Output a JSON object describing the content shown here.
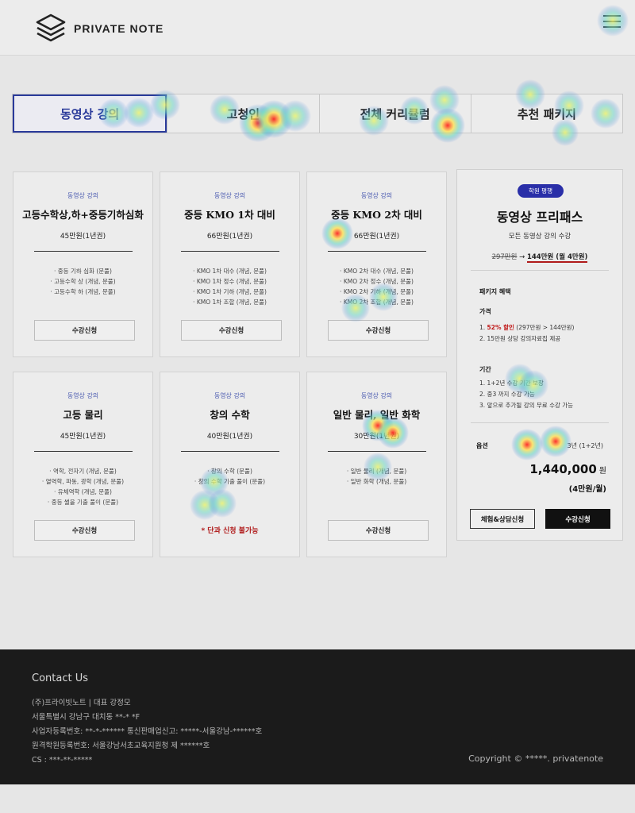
{
  "header": {
    "logo_text": "PRIVATE NOTE"
  },
  "tabs": [
    {
      "label": "동영상 강의"
    },
    {
      "label": "고청인"
    },
    {
      "label": "전체 커리큘럼"
    },
    {
      "label": "추천 패키지"
    }
  ],
  "courses": [
    {
      "category": "동영상 강의",
      "title": "고등수학상,하+중등기하심화",
      "price": "45만원(1년권)",
      "topics": [
        "· 중등 기하 심화 (문풀)",
        "· 고등수학 상 (개념, 문풀)",
        "· 고등수학 하 (개념, 문풀)"
      ],
      "button": "수강신청"
    },
    {
      "category": "동영상 강의",
      "title": "중등 KMO 1차 대비",
      "price": "66만원(1년권)",
      "topics": [
        "· KMO 1차 대수 (개념, 문풀)",
        "· KMO 1차 정수 (개념, 문풀)",
        "· KMO 1차 기하 (개념, 문풀)",
        "· KMO 1차 조합 (개념, 문풀)"
      ],
      "button": "수강신청"
    },
    {
      "category": "동영상 강의",
      "title": "중등 KMO 2차 대비",
      "price": "66만원(1년권)",
      "topics": [
        "· KMO 2차 대수 (개념, 문풀)",
        "· KMO 2차 정수 (개념, 문풀)",
        "· KMO 2차 기하 (개념, 문풀)",
        "· KMO 2차 조합 (개념, 문풀)"
      ],
      "button": "수강신청"
    },
    {
      "category": "동영상 강의",
      "title": "고등 물리",
      "price": "45만원(1년권)",
      "topics": [
        "· 역학, 전자기 (개념, 문풀)",
        "· 열역학, 파동, 광학 (개념, 문풀)",
        "· 유체역학 (개념, 문풀)",
        "· 중등 썰을 기출 풀이 (문풀)"
      ],
      "button": "수강신청"
    },
    {
      "category": "동영상 강의",
      "title": "창의 수학",
      "price": "40만원(1년권)",
      "topics": [
        "· 창의 수학 (문풀)",
        "· 창의 수학 기출 풀이 (문풀)"
      ],
      "notice": "* 단과 신청 불가능"
    },
    {
      "category": "동영상 강의",
      "title": "일반 물리, 일반 화학",
      "price": "30만원(1년권)",
      "topics": [
        "· 일반 물리 (개념, 문풀)",
        "· 일반 화학 (개념, 문풀)"
      ],
      "button": "수강신청"
    }
  ],
  "premium": {
    "badge": "학원 평행",
    "title": "동영상 프리패스",
    "subtitle": "모든 동영상 강의 수강",
    "old_price": "297만원",
    "arrow": "→",
    "new_price": "144만원 (월 4만원)",
    "benefits_label": "패키지 혜택",
    "price_label": "가격",
    "price_item1_prefix": "1. ",
    "price_item1_red": "52% 할인",
    "price_item1_rest": " (297만원 > 144만원)",
    "price_item2": "2. 15만원 상당 강의자료집 제공",
    "period_label": "기간",
    "period_item1": "1. 1+2년 수강 기간 보장",
    "period_item2": "2. 중3 까지 수강 가능",
    "period_item3": "3. 앞으로 추가될 강의 무료 수강 가능",
    "option_label": "옵션",
    "option_value": "3년 (1+2년)",
    "total": "1,440,000",
    "total_unit": "원",
    "monthly": "(4만원/월)",
    "consult_button": "체험&상담신청",
    "enroll_button": "수강신청"
  },
  "footer": {
    "title": "Contact Us",
    "lines": [
      "(주)프라이빗노트 | 대표 강정모",
      "서울특별시 강남구 대치동 **-* *F",
      "사업자등록번호: **-*-****** 통신판매업신고: *****-서울강남-******호",
      "원격학원등록번호: 서울강남서초교육지원청 제 ******호",
      "CS : ***-**-*****"
    ],
    "copyright": "Copyright © *****. privatenote"
  },
  "colors": {
    "accent": "#2a2fa8",
    "tab_active": "#2a3a9a",
    "warning": "#b01a1a",
    "footer_bg": "#1b1b1b"
  }
}
